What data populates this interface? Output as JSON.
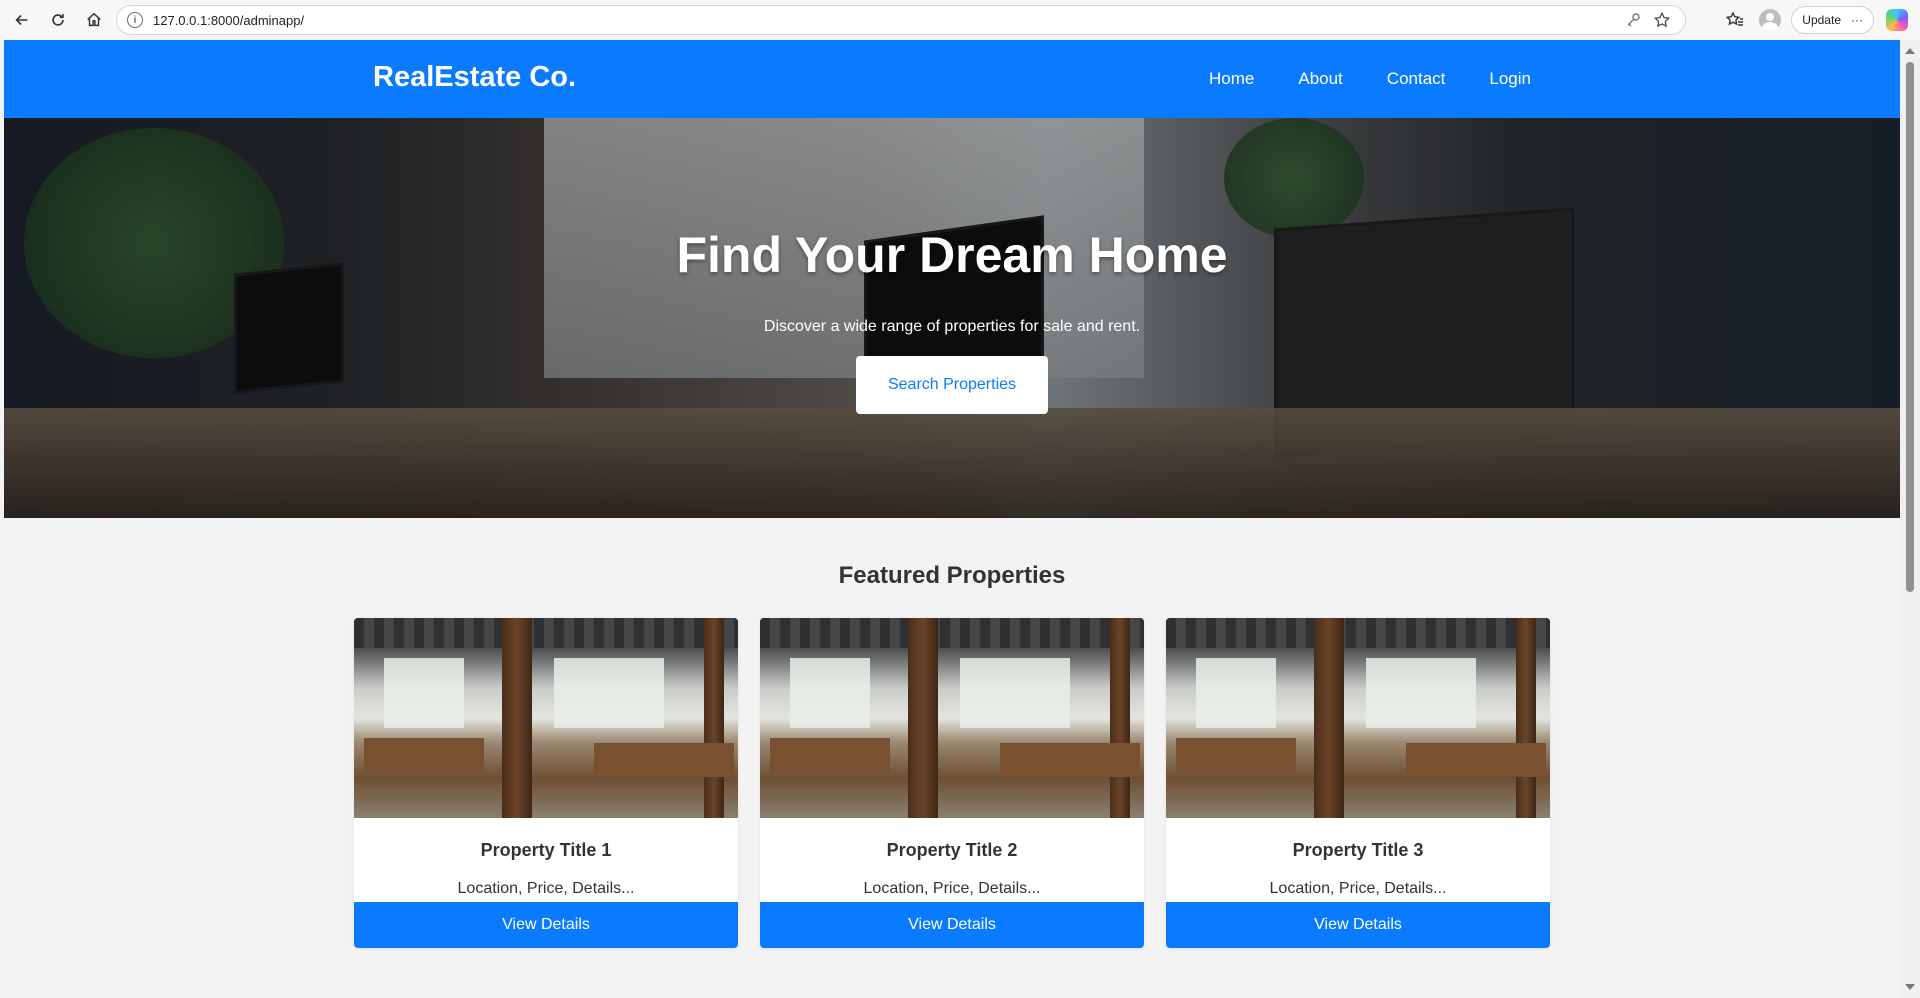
{
  "browser": {
    "url": "127.0.0.1:8000/adminapp/",
    "update_label": "Update",
    "more_label": "···"
  },
  "site": {
    "brand": "RealEstate Co.",
    "nav": [
      "Home",
      "About",
      "Contact",
      "Login"
    ],
    "accent": "#0a7bff"
  },
  "hero": {
    "title": "Find Your Dream Home",
    "subtitle": "Discover a wide range of properties for sale and rent.",
    "button": "Search Properties"
  },
  "featured": {
    "heading": "Featured Properties",
    "cards": [
      {
        "title": "Property Title 1",
        "desc": "Location, Price, Details...",
        "button": "View Details"
      },
      {
        "title": "Property Title 2",
        "desc": "Location, Price, Details...",
        "button": "View Details"
      },
      {
        "title": "Property Title 3",
        "desc": "Location, Price, Details...",
        "button": "View Details"
      }
    ]
  }
}
